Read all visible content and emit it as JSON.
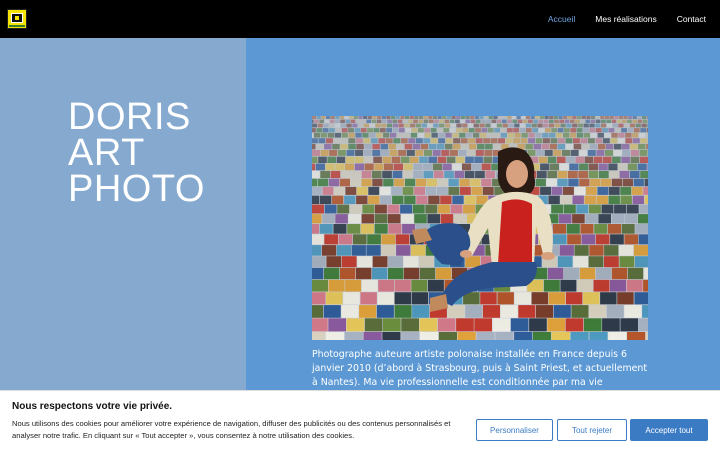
{
  "header": {
    "logo": "doris-art-photo-logo",
    "nav": [
      {
        "label": "Accueil",
        "active": true
      },
      {
        "label": "Mes réalisations",
        "active": false
      },
      {
        "label": "Contact",
        "active": false
      }
    ]
  },
  "hero": {
    "title_lines": [
      "DORIS",
      "ART",
      "PHOTO"
    ],
    "photo": "woman-sitting-on-floor-of-photo-tiles",
    "description": "Photographe auteure artiste polonaise installée en France depuis 6 janvier 2010 (d’abord à Strasbourg, puis à Saint Priest, et actuellement à Nantes). Ma vie professionnelle est conditionnée par ma vie personnelle – familiale. Du"
  },
  "cookie_banner": {
    "title": "Nous respectons votre vie privée.",
    "text": "Nous utilisons des cookies pour améliorer votre expérience de navigation, diffuser des publicités ou des contenus personnalisés et analyser notre trafic. En cliquant sur « Tout accepter », vous consentez à notre utilisation des cookies.",
    "buttons": {
      "customize": "Personnaliser",
      "reject": "Tout rejeter",
      "accept": "Accepter tout"
    }
  },
  "colors": {
    "header_bg": "#000000",
    "nav_active": "#6fa6e0",
    "left_panel": "#85a9cf",
    "right_panel": "#5b98d4",
    "accent": "#3b7bc4"
  }
}
